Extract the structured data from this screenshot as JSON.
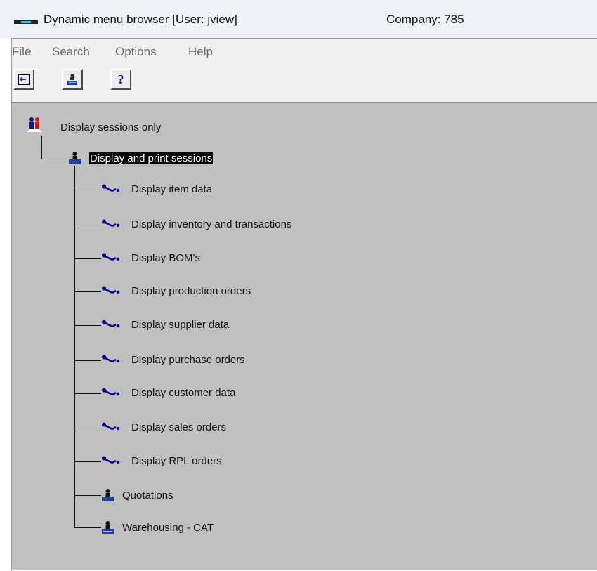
{
  "window": {
    "title": "Dynamic menu browser [User: jview]",
    "company": "Company: 785"
  },
  "menu": [
    "File",
    "Search",
    "Options",
    "Help"
  ],
  "toolbar": {
    "exit_icon": "exit-arrow-icon",
    "session_icon": "person-session-icon",
    "help_label": "?"
  },
  "tree": {
    "root": {
      "label": "Display sessions only",
      "icon": "users-group-icon"
    },
    "child": {
      "label": "Display and print sessions",
      "icon": "person-session-icon",
      "selected": true
    },
    "items": [
      {
        "label": "Display item data",
        "icon": "session-key-icon"
      },
      {
        "label": "Display inventory and transactions",
        "icon": "session-key-icon"
      },
      {
        "label": "Display BOM's",
        "icon": "session-key-icon"
      },
      {
        "label": "Display production orders",
        "icon": "session-key-icon"
      },
      {
        "label": "Display supplier data",
        "icon": "session-key-icon"
      },
      {
        "label": "Display purchase orders",
        "icon": "session-key-icon"
      },
      {
        "label": "Display customer data",
        "icon": "session-key-icon"
      },
      {
        "label": "Display sales orders",
        "icon": "session-key-icon"
      },
      {
        "label": "Display RPL orders",
        "icon": "session-key-icon"
      },
      {
        "label": "Quotations",
        "icon": "person-session-icon"
      },
      {
        "label": "Warehousing - CAT",
        "icon": "person-session-icon"
      }
    ]
  },
  "colors": {
    "tree_background": "#c0c0c0",
    "selection_background": "#000000",
    "selection_text": "#ffffff",
    "key_icon": "#00008b"
  }
}
